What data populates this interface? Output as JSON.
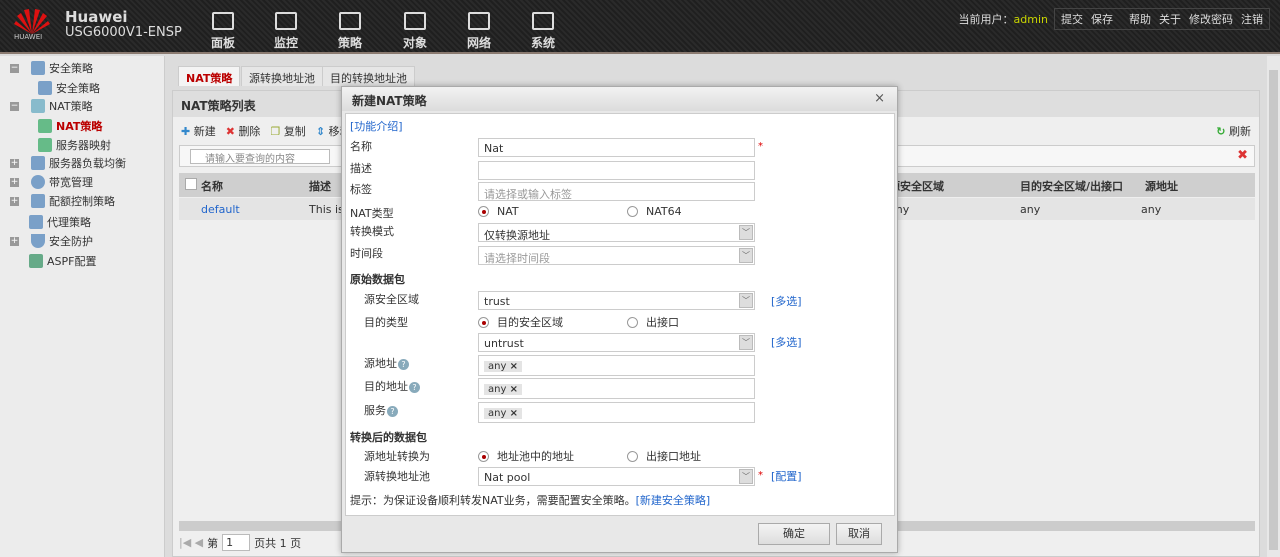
{
  "header": {
    "brand": "Huawei",
    "model": "USG6000V1-ENSP",
    "logo_text": "HUAWEI",
    "nav": [
      {
        "label": "面板",
        "icon": "dashboard-icon"
      },
      {
        "label": "监控",
        "icon": "monitor-icon"
      },
      {
        "label": "策略",
        "icon": "policy-icon"
      },
      {
        "label": "对象",
        "icon": "object-icon"
      },
      {
        "label": "网络",
        "icon": "network-icon"
      },
      {
        "label": "系统",
        "icon": "system-icon"
      }
    ],
    "user_label": "当前用户：",
    "user": "admin",
    "actions": [
      "提交",
      "保存",
      "帮助",
      "关于",
      "修改密码",
      "注销"
    ]
  },
  "sidebar": {
    "items": [
      {
        "label": "安全策略",
        "expand": "−"
      },
      {
        "label": "安全策略"
      },
      {
        "label": "NAT策略",
        "expand": "−"
      },
      {
        "label": "NAT策略"
      },
      {
        "label": "服务器映射"
      },
      {
        "label": "服务器负载均衡",
        "expand": "+"
      },
      {
        "label": "带宽管理",
        "expand": "+"
      },
      {
        "label": "配额控制策略",
        "expand": "+"
      },
      {
        "label": "代理策略"
      },
      {
        "label": "安全防护",
        "expand": "+"
      },
      {
        "label": "ASPF配置"
      }
    ]
  },
  "tabs": [
    "NAT策略",
    "源转换地址池",
    "目的转换地址池"
  ],
  "list": {
    "title": "NAT策略列表",
    "toolbar": [
      "新建",
      "删除",
      "复制",
      "移动"
    ],
    "refresh": "刷新",
    "search_placeholder": "请输入要查询的内容",
    "columns": [
      "名称",
      "描述",
      "源安全区域",
      "目的安全区域/出接口",
      "源地址"
    ],
    "rows": [
      {
        "name": "default",
        "desc": "This is",
        "src_zone": "any",
        "dst_zone": "any",
        "src_addr": "any"
      }
    ],
    "pager": {
      "prefix": "第",
      "page": "1",
      "suffix": "页共 1 页"
    }
  },
  "dialog": {
    "title": "新建NAT策略",
    "close": "×",
    "intro_link": "[功能介绍]",
    "name_label": "名称",
    "name_value": "Nat",
    "desc_label": "描述",
    "desc_value": "",
    "tag_label": "标签",
    "tag_placeholder": "请选择或输入标签",
    "nat_type_label": "NAT类型",
    "nat_type_options": [
      "NAT",
      "NAT64"
    ],
    "mode_label": "转换模式",
    "mode_value": "仅转换源地址",
    "time_label": "时间段",
    "time_placeholder": "请选择时间段",
    "original_section": "原始数据包",
    "src_zone_label": "源安全区域",
    "src_zone_value": "trust",
    "multi": "[多选]",
    "dst_type_label": "目的类型",
    "dst_type_options": [
      "目的安全区域",
      "出接口"
    ],
    "dst_zone_value": "untrust",
    "src_addr_label": "源地址",
    "dst_addr_label": "目的地址",
    "service_label": "服务",
    "any_tag": "any",
    "tag_remove": "×",
    "help": "?",
    "translated_section": "转换后的数据包",
    "src_trans_label": "源地址转换为",
    "src_trans_options": [
      "地址池中的地址",
      "出接口地址"
    ],
    "pool_label": "源转换地址池",
    "pool_value": "Nat pool",
    "config_link": "[配置]",
    "hint": "提示：为保证设备顺利转发NAT业务，需要配置安全策略。",
    "hint_link": "[新建安全策略]",
    "ok": "确定",
    "cancel": "取消",
    "required": "*"
  }
}
